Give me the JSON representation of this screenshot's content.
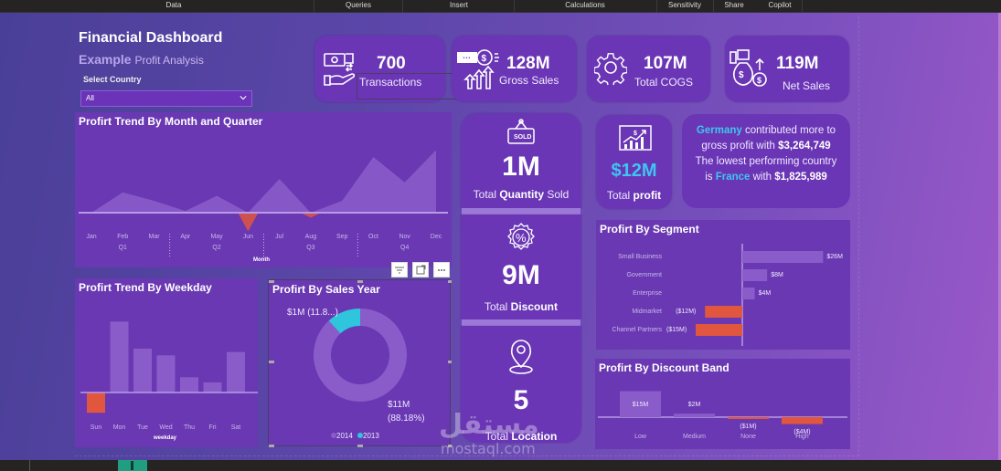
{
  "menu": {
    "items": [
      "Data",
      "Queries",
      "Insert",
      "Calculations",
      "Sensitivity",
      "Share",
      "Copilot"
    ]
  },
  "header": {
    "title": "Financial Dashboard",
    "subtitle_bold": "Example",
    "subtitle_rest": "Profit Analysis",
    "slicer_label": "Select Country",
    "slicer_value": "All"
  },
  "kpis": [
    {
      "id": "transactions",
      "value": "700",
      "label": "Transactions",
      "icon": "money-hand-icon"
    },
    {
      "id": "gross_sales",
      "value": "128M",
      "label": "Gross Sales",
      "icon": "coin-growth-icon"
    },
    {
      "id": "cogs",
      "value": "107M",
      "label": "Total COGS",
      "icon": "gear-icon"
    },
    {
      "id": "net_sales",
      "value": "119M",
      "label": "Net Sales",
      "icon": "money-bag-icon"
    }
  ],
  "middle_column": {
    "quantity": {
      "value": "1M",
      "label_pre": "Total ",
      "label_bold": "Quantity",
      "label_post": " Sold",
      "icon": "sold-sign-icon"
    },
    "discount": {
      "value": "9M",
      "label_pre": "Total ",
      "label_bold": "Discount",
      "icon": "percent-badge-icon"
    },
    "location": {
      "value": "5",
      "label_pre": "Total ",
      "label_bold": "Location",
      "icon": "location-pin-icon"
    }
  },
  "profit_card": {
    "value": "$12M",
    "label_pre": "Total ",
    "label_bold": "profit",
    "icon": "growth-chart-icon",
    "value_color": "#3ec6f0"
  },
  "insight": {
    "top_country": "Germany",
    "line1_rest": " contributed more to",
    "line2_pre": "gross profit with ",
    "top_amount": "$3,264,749",
    "line3": "The lowest performing country",
    "line4_pre": "is ",
    "low_country": "France",
    "line4_mid": " with ",
    "low_amount": "$1,825,989"
  },
  "visual_header": {
    "buttons": [
      "filter-icon",
      "focus-mode-icon",
      "more-options-icon"
    ]
  },
  "watermark": {
    "arabic": "مستقل",
    "latin": "mostaql.com"
  },
  "colors": {
    "positive": "#8a5cc9",
    "negative": "#e0563e",
    "accent": "#3ec6f0",
    "card": "#6a36b5",
    "panel": "#6938b2"
  },
  "chart_data": [
    {
      "id": "month_trend",
      "type": "area",
      "title": "Profirt Trend By Month and Quarter",
      "xlabel": "Month",
      "categories": [
        "Jan",
        "Feb",
        "Mar",
        "Apr",
        "May",
        "Jun",
        "Jul",
        "Aug",
        "Sep",
        "Oct",
        "Nov",
        "Dec"
      ],
      "quarters": [
        "Q1",
        "Q2",
        "Q3",
        "Q4"
      ],
      "values": [
        0.0,
        0.6,
        0.35,
        0.05,
        0.5,
        -0.55,
        1.0,
        -0.15,
        0.35,
        1.65,
        0.9,
        1.85
      ],
      "ylabel": "",
      "grid": false
    },
    {
      "id": "weekday_trend",
      "type": "bar",
      "title": "Profirt Trend By Weekday",
      "xlabel": "weekday",
      "categories": [
        "Sun",
        "Mon",
        "Tue",
        "Wed",
        "Thu",
        "Fri",
        "Sat"
      ],
      "values": [
        -0.6,
        2.1,
        1.3,
        1.1,
        0.45,
        0.3,
        1.2
      ],
      "grid": false
    },
    {
      "id": "sales_year",
      "type": "pie",
      "title": "Profirt By Sales Year",
      "categories": [
        "2014",
        "2013"
      ],
      "values": [
        88.18,
        11.82
      ],
      "labels": [
        "$11M",
        "(88.18%)",
        "$1M (11.8...)"
      ],
      "legend": [
        "2014",
        "2013"
      ],
      "legend_position": "bottom",
      "colors": [
        "#8a5cc9",
        "#2ec5dd"
      ]
    },
    {
      "id": "segment",
      "type": "bar",
      "orientation": "horizontal",
      "title": "Profirt By Segment",
      "categories": [
        "Small Business",
        "Government",
        "Enterprise",
        "Midmarket",
        "Channel Partners"
      ],
      "values": [
        26,
        8,
        4,
        -12,
        -15
      ],
      "labels": [
        "$26M",
        "$8M",
        "$4M",
        "($12M)",
        "($15M)"
      ],
      "unit": "M$"
    },
    {
      "id": "discount_band",
      "type": "bar",
      "title": "Profirt By Discount Band",
      "categories": [
        "Low",
        "Medium",
        "None",
        "High"
      ],
      "values": [
        15,
        2,
        -1,
        -4
      ],
      "labels": [
        "$15M",
        "$2M",
        "($1M)",
        "($4M)"
      ],
      "unit": "M$"
    }
  ]
}
